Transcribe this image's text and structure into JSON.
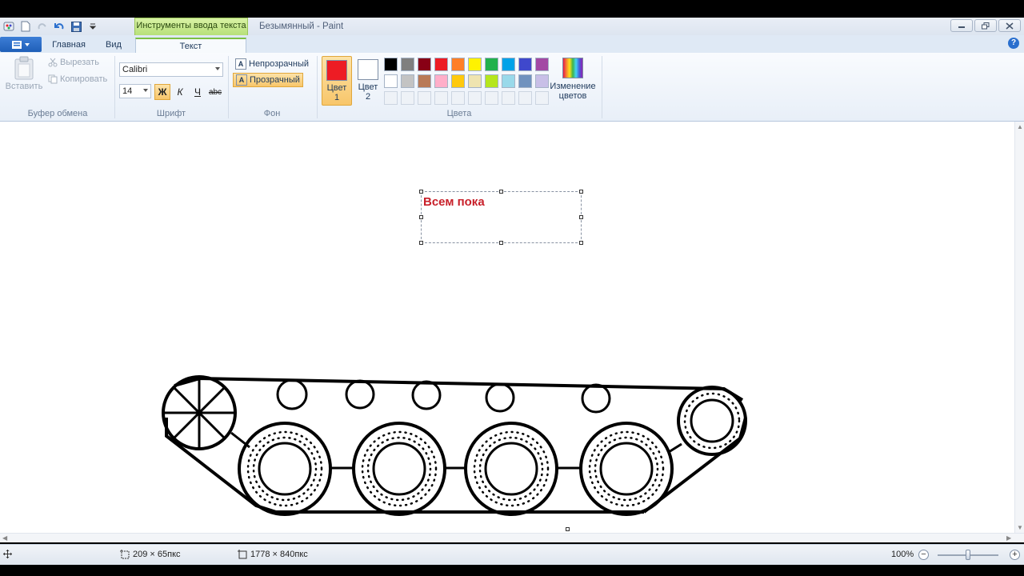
{
  "window": {
    "context_tab": "Инструменты ввода текста",
    "title": "Безымянный - Paint"
  },
  "tabs": {
    "home": "Главная",
    "view": "Вид",
    "text": "Текст"
  },
  "clipboard": {
    "paste": "Вставить",
    "cut": "Вырезать",
    "copy": "Копировать",
    "group": "Буфер обмена"
  },
  "font": {
    "family": "Calibri",
    "size": "14",
    "bold": "Ж",
    "italic": "К",
    "underline": "Ч",
    "strike": "abc",
    "group": "Шрифт"
  },
  "background": {
    "opaque": "Непрозрачный",
    "transparent": "Прозрачный",
    "group": "Фон"
  },
  "colors": {
    "color1_label": "Цвет",
    "color1_num": "1",
    "color2_label": "Цвет",
    "color2_num": "2",
    "edit_label_1": "Изменение",
    "edit_label_2": "цветов",
    "group": "Цвета",
    "color1_value": "#ed1c24",
    "color2_value": "#ffffff",
    "row1": [
      "#000000",
      "#7f7f7f",
      "#880015",
      "#ed1c24",
      "#ff7f27",
      "#fff200",
      "#22b14c",
      "#00a2e8",
      "#3f48cc",
      "#a349a4"
    ],
    "row2": [
      "#ffffff",
      "#c3c3c3",
      "#b97a57",
      "#ffaec9",
      "#ffc90e",
      "#efe4b0",
      "#b5e61d",
      "#99d9ea",
      "#7092be",
      "#c8bfe7"
    ]
  },
  "canvas": {
    "text": "Всем пока"
  },
  "status": {
    "selection_size": "209 × 65пкс",
    "image_size": "1778 × 840пкс",
    "zoom": "100%"
  }
}
